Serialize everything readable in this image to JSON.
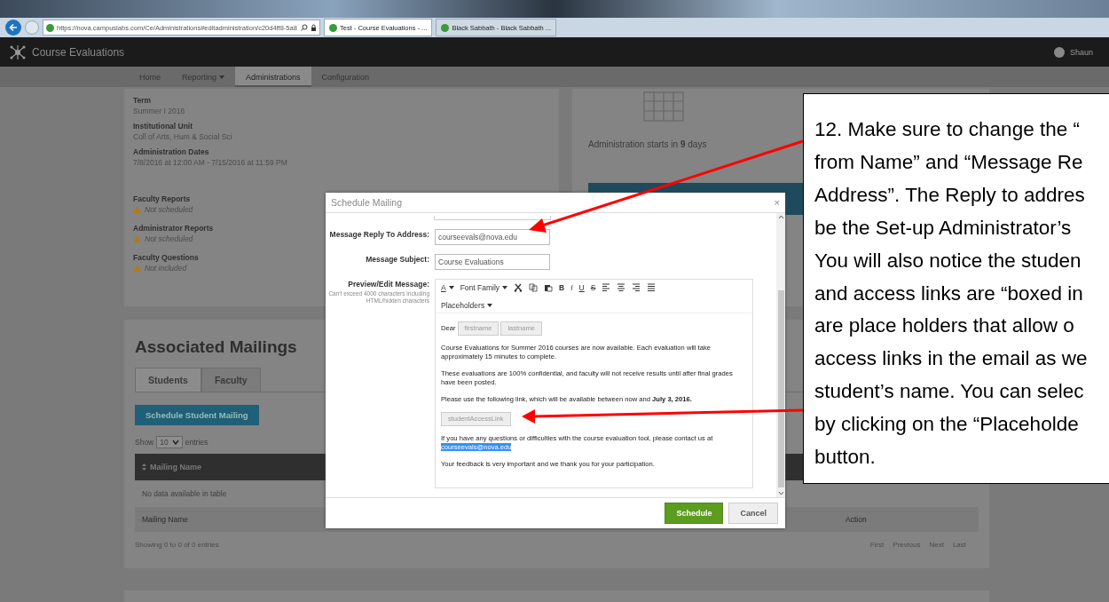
{
  "browser": {
    "address": "https://nova.campuslabs.com/Ce/Administrations#editadministration/c20d4ff8-5a8",
    "tabs": [
      {
        "label": "Test - Course Evaluations - ...",
        "selected": true
      },
      {
        "label": "Black Sabbath - Black Sabbath ...",
        "selected": false
      }
    ]
  },
  "app": {
    "title": "Course Evaluations",
    "user": "Shaun",
    "nav": [
      {
        "label": "Home",
        "selected": false,
        "dropdown": false
      },
      {
        "label": "Reporting",
        "selected": false,
        "dropdown": true
      },
      {
        "label": "Administrations",
        "selected": true,
        "dropdown": false
      },
      {
        "label": "Configuration",
        "selected": false,
        "dropdown": false
      }
    ]
  },
  "details": [
    {
      "label": "Term",
      "value": "Summer I 2016",
      "kind": "plain"
    },
    {
      "label": "Institutional Unit",
      "value": "Coll of Arts, Hum & Social Sci",
      "kind": "plain"
    },
    {
      "label": "Administration Dates",
      "value": "7/8/2016 at 12:00 AM - 7/15/2016 at 11:59 PM",
      "kind": "plain"
    },
    {
      "label": "Faculty Reports",
      "value": "Not scheduled",
      "kind": "warning"
    },
    {
      "label": "Administrator Reports",
      "value": "Not scheduled",
      "kind": "warning"
    },
    {
      "label": "Faculty Questions",
      "value": "Not included",
      "kind": "warning"
    }
  ],
  "status_card": {
    "text": "Administration starts in **9** days"
  },
  "mailings": {
    "title": "Associated Mailings",
    "tabs": [
      {
        "label": "Students",
        "selected": true
      },
      {
        "label": "Faculty",
        "selected": false
      }
    ],
    "button": "Schedule Student Mailing",
    "show_label": "Show",
    "page_size": "10",
    "entries_label": "entries",
    "column": "Mailing Name",
    "empty": "No data available in table",
    "footer_columns": [
      "Mailing Name",
      "Action"
    ],
    "info": "Showing 0 to 0 of 0 entries",
    "pagination": [
      "First",
      "Previous",
      "Next",
      "Last"
    ]
  },
  "modal": {
    "title": "Schedule Mailing",
    "close": "×",
    "fields": [
      {
        "label": "Message Reply To Address:",
        "value": "courseevals@nova.edu"
      },
      {
        "label": "Message Subject:",
        "value": "Course Evaluations"
      }
    ],
    "editor": {
      "label": "Preview/Edit Message:",
      "hint": "Can't exceed 4000 characters including HTML/hidden characters",
      "toolbar": [
        {
          "kind": "color",
          "label": "A"
        },
        {
          "kind": "dropdown",
          "label": "Font Family"
        },
        {
          "kind": "cut"
        },
        {
          "kind": "copy"
        },
        {
          "kind": "paste"
        },
        {
          "kind": "bold",
          "label": "B"
        },
        {
          "kind": "italic",
          "label": "I"
        },
        {
          "kind": "underline",
          "label": "U"
        },
        {
          "kind": "strike",
          "label": "S"
        },
        {
          "kind": "align-left"
        },
        {
          "kind": "align-center"
        },
        {
          "kind": "align-right"
        },
        {
          "kind": "justify"
        }
      ],
      "placeholders_menu": "Placeholders",
      "greeting": "Dear",
      "name_chips": [
        "firstname",
        "lastname"
      ],
      "paragraphs": [
        "Course Evaluations for Summer 2016 courses are now available. Each evaluation will take approximately 15 minutes to complete.",
        "These evaluations are 100% confidential, and faculty will not receive results until after final grades have been posted.",
        "Please use the following link, which will be available between now and **July 3, 2016.**"
      ],
      "link_chip": "studentAccessLink",
      "contact": "If you have any questions or difficulties with the course evaluation tool, please contact us at",
      "contact_email": "courseevals@nova.edu",
      "closing": "Your feedback is very important and we thank you for your participation."
    },
    "buttons": [
      {
        "label": "Schedule",
        "kind": "primary"
      },
      {
        "label": "Cancel",
        "kind": "secondary"
      }
    ]
  },
  "callout": {
    "lines": [
      "12. Make sure to change the “",
      "from Name” and “Message Re",
      "Address”. The Reply to addres",
      "be the Set-up Administrator’s",
      "You will also notice the studen",
      "and access links are “boxed in",
      "are place holders that allow o",
      "access links in the email as we",
      "student’s name. You can selec",
      "by clicking on the “Placeholde",
      "button."
    ]
  }
}
